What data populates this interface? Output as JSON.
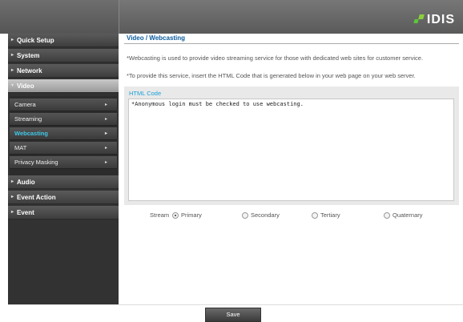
{
  "brand": {
    "logo_text": "IDIS"
  },
  "sidebar": {
    "items": [
      {
        "label": "Quick Setup"
      },
      {
        "label": "System"
      },
      {
        "label": "Network"
      },
      {
        "label": "Video"
      },
      {
        "label": "Audio"
      },
      {
        "label": "Event Action"
      },
      {
        "label": "Event"
      }
    ],
    "video_sub": [
      {
        "label": "Camera"
      },
      {
        "label": "Streaming"
      },
      {
        "label": "Webcasting"
      },
      {
        "label": "MAT"
      },
      {
        "label": "Privacy Masking"
      }
    ]
  },
  "main": {
    "title": "Video / Webcasting",
    "desc1": "*Webcasting is used to provide video streaming service for those with dedicated web sites for customer service.",
    "desc2": "*To provide this service, insert the HTML Code that is generated below in your web page on your web server.",
    "code_label": "HTML Code",
    "code_value": "*Anonymous login must be checked to use webcasting.",
    "stream_label": "Stream",
    "stream_options": [
      {
        "label": "Primary",
        "selected": true
      },
      {
        "label": "Secondary",
        "selected": false
      },
      {
        "label": "Tertiary",
        "selected": false
      },
      {
        "label": "Quaternary",
        "selected": false
      }
    ]
  },
  "footer": {
    "save_label": "Save"
  },
  "colors": {
    "title": "#0a5b9c",
    "accent": "#3fc8e8",
    "code_label": "#1aa0d8",
    "logo_green": "#5cc73a"
  }
}
